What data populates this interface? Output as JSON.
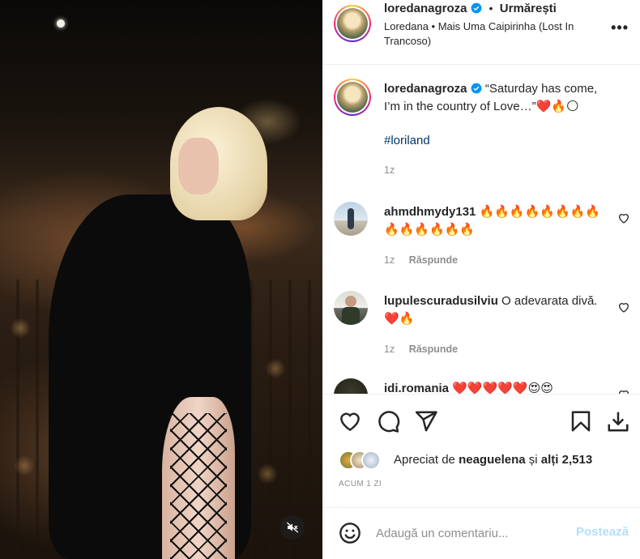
{
  "post": {
    "username": "loredanagroza",
    "separator": "•",
    "follow_label": "Urmărești",
    "audio": "Loredana • Mais Uma Caipirinha (Lost In Trancoso)",
    "more_label": "•••"
  },
  "caption": {
    "username": "loredanagroza",
    "text": "“Saturday has come, I’m in the country of Love…”",
    "emojis": "❤️🔥🌕",
    "hashtag": "#loriland",
    "time": "1z"
  },
  "comments": [
    {
      "username": "ahmdhmydy131",
      "text": "🔥🔥🔥🔥🔥🔥🔥🔥🔥🔥🔥🔥🔥🔥",
      "time": "1z",
      "reply_label": "Răspunde"
    },
    {
      "username": "lupulescuradusilviu",
      "text": "O adevarata divă.❤️🔥",
      "time": "1z",
      "reply_label": "Răspunde"
    },
    {
      "username": "idi.romania",
      "text": "❤️❤️❤️❤️❤️😍😍"
    }
  ],
  "likes": {
    "prefix": "Apreciat de",
    "user": "neaguelena",
    "connector": "și",
    "others": "alți 2,513"
  },
  "timestamp": "ACUM 1 ZI",
  "composer": {
    "placeholder": "Adaugă un comentariu...",
    "post_label": "Postează"
  },
  "colors": {
    "verified": "#0095f6",
    "link": "#00376b",
    "muted": "#8e8e8e",
    "post_disabled": "#b2dffc"
  },
  "icons": [
    "verified-icon",
    "heart-icon",
    "comment-icon",
    "share-icon",
    "bookmark-icon",
    "download-icon",
    "emoji-icon",
    "mute-icon"
  ]
}
